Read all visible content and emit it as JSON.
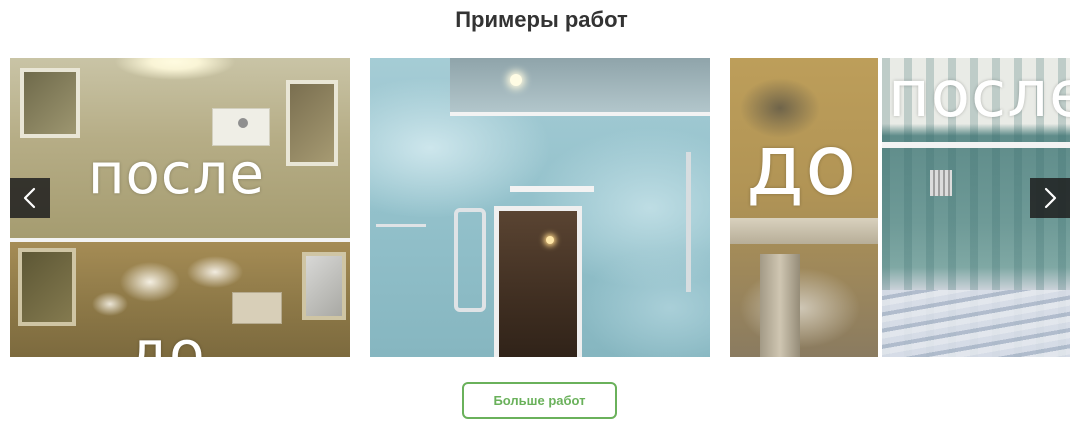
{
  "section": {
    "title": "Примеры работ"
  },
  "gallery": {
    "slides": [
      {
        "top_caption": "после",
        "bottom_caption": "до"
      },
      {
        "description": ""
      },
      {
        "left_caption": "до",
        "right_caption": "после"
      }
    ],
    "prev_icon": "chevron-left-icon",
    "next_icon": "chevron-right-icon"
  },
  "more_button": {
    "label": "Больше работ",
    "color": "#6ab15b"
  }
}
